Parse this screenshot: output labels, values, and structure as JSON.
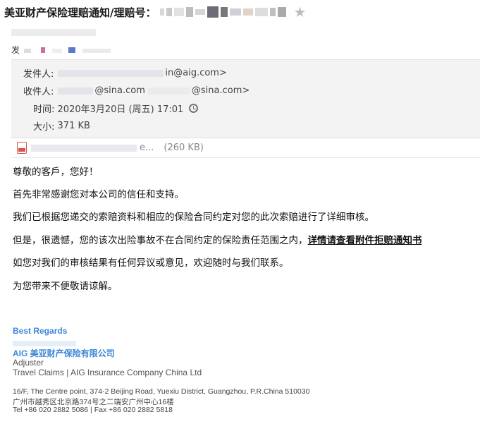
{
  "subject": {
    "title": "美亚财产保险理赔通知/理赔号：",
    "star_icon": "star-icon"
  },
  "sender_block": {
    "line2_prefix": "发"
  },
  "details": {
    "from_label": "发件人:",
    "from_value": "in@aig.com>",
    "to_label": "收件人:",
    "to_value_1": "@sina.com",
    "to_value_2": "@sina.com>",
    "time_label": "时间:",
    "time_value": "2020年3月20日 (周五) 17:01",
    "size_label": "大小:",
    "size_value": "371 KB"
  },
  "attachment": {
    "name_suffix": "e...",
    "size": "(260 KB)"
  },
  "body": {
    "greeting": "尊敬的客戶，您好！",
    "p1": "首先非常感谢您对本公司的信任和支持。",
    "p2": "我们已根据您递交的索赔资料和相应的保险合同约定对您的此次索赔进行了详细审核。",
    "p3_text": "但是，很遗憾，您的该次出险事故不在合同约定的保险责任范围之内，",
    "p3_link": "详情请查看附件拒赔通知书",
    "p4": "如您对我们的审核结果有任何异议或意见，欢迎随时与我们联系。",
    "p5": "为您带来不便敬请谅解。"
  },
  "signature": {
    "best_regards": "Best Regards",
    "company_cn": "AIG 美亚财产保险有限公司",
    "title": "Adjuster",
    "dept": "Travel Claims | AIG Insurance Company China Ltd",
    "addr_en": "16/F, The Centre point, 374-2 Beijing Road, Yuexiu District, Guangzhou, P.R.China 510030",
    "addr_cn": "广州市越秀区北京路374号之二端安广州中心16楼",
    "phone": "Tel +86 020 2882 5086 | Fax +86 020 2882 5818"
  },
  "colors": {
    "signature_blue": "#3b86d9",
    "details_bg": "#f3f3f3",
    "star_grey": "#bdbdbd"
  }
}
